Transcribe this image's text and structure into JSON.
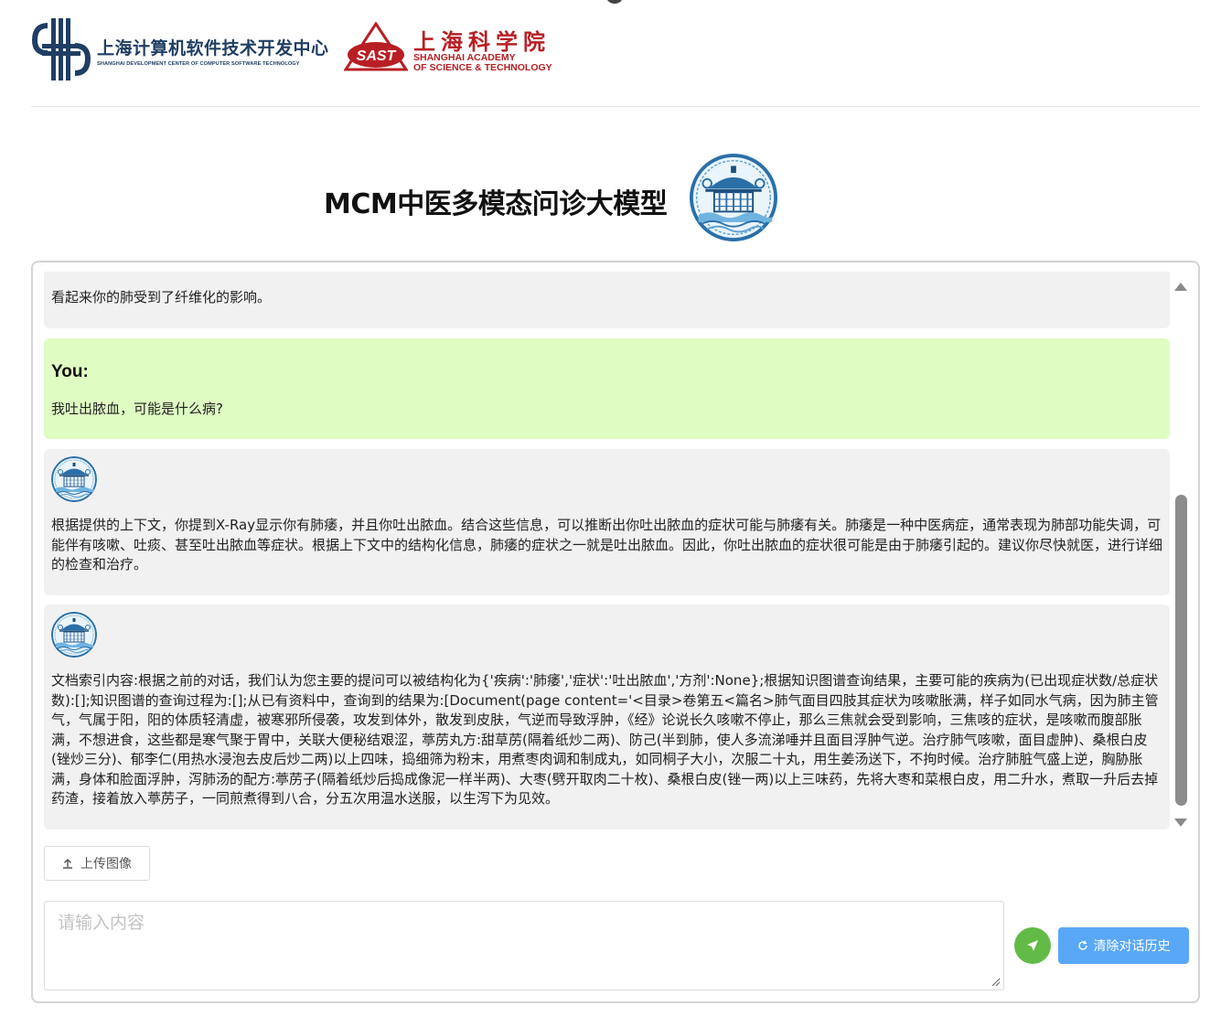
{
  "header": {
    "sdc_logo": {
      "name_cn": "上海计算机软件技术开发中心",
      "name_en": "SHANGHAI DEVELOPMENT CENTER OF COMPUTER SOFTWARE TECHNOLOGY"
    },
    "sast_logo": {
      "mark_text": "SAST",
      "name_cn": "上海科学院",
      "name_en_line1": "SHANGHAI ACADEMY",
      "name_en_line2": "OF SCIENCE & TECHNOLOGY"
    }
  },
  "page": {
    "title": "MCM中医多模态问诊大模型"
  },
  "chat": {
    "messages": [
      {
        "role": "bot",
        "text": "看起来你的肺受到了纤维化的影响。"
      },
      {
        "role": "user",
        "label": "You:",
        "text": "我吐出脓血，可能是什么病?"
      },
      {
        "role": "bot",
        "text": "根据提供的上下文，你提到X-Ray显示你有肺痿，并且你吐出脓血。结合这些信息，可以推断出你吐出脓血的症状可能与肺痿有关。肺痿是一种中医病症，通常表现为肺部功能失调，可能伴有咳嗽、吐痰、甚至吐出脓血等症状。根据上下文中的结构化信息，肺痿的症状之一就是吐出脓血。因此，你吐出脓血的症状很可能是由于肺痿引起的。建议你尽快就医，进行详细的检查和治疗。"
      },
      {
        "role": "bot",
        "text": "文档索引内容:根据之前的对话，我们认为您主要的提问可以被结构化为{'疾病':'肺痿','症状':'吐出脓血','方剂':None};根据知识图谱查询结果，主要可能的疾病为(已出现症状数/总症状数):[];知识图谱的查询过程为:[];从已有资料中，查询到的结果为:[Document(page content='<目录>卷第五<篇名>肺气面目四肢其症状为咳嗽胀满，样子如同水气病，因为肺主管气，气属于阳，阳的体质轻清虚，被寒邪所侵袭，攻发到体外，散发到皮肤，气逆而导致浮肿，《经》论说长久咳嗽不停止，那么三焦就会受到影响，三焦咳的症状，是咳嗽而腹部胀满，不想进食，这些都是寒气聚于胃中，关联大便秘结艰涩，葶苈丸方:甜草苈(隔着纸炒二两)、防己(半到肺，使人多流涕唾并且面目浮肿气逆。治疗肺气咳嗽，面目虚肿)、桑根白皮(锉炒三分)、郁李仁(用热水浸泡去皮后炒二两)以上四味，捣细筛为粉末，用煮枣肉调和制成丸，如同桐子大小，次服二十丸，用生姜汤送下，不拘时候。治疗肺脏气盛上逆，胸胁胀满，身体和脸面浮肿，泻肺汤的配方:葶苈子(隔着纸炒后捣成像泥一样半两)、大枣(劈开取肉二十枚)、桑根白皮(锉一两)以上三味药，先将大枣和菜根白皮，用二升水，煮取一升后去掉药渣，接着放入葶苈子，一同煎煮得到八合，分五次用温水送服，以生泻下为见效。"
      }
    ]
  },
  "controls": {
    "upload_label": "上传图像",
    "input_placeholder": "请输入内容",
    "input_value": "",
    "clear_label": "清除对话历史"
  },
  "colors": {
    "user_bubble": "#dffcc2",
    "bot_bubble": "#f1f1f1",
    "send_button": "#62bb47",
    "clear_button": "#59a8f7",
    "sast_red": "#b81f24",
    "sdc_blue": "#1f3e63"
  }
}
